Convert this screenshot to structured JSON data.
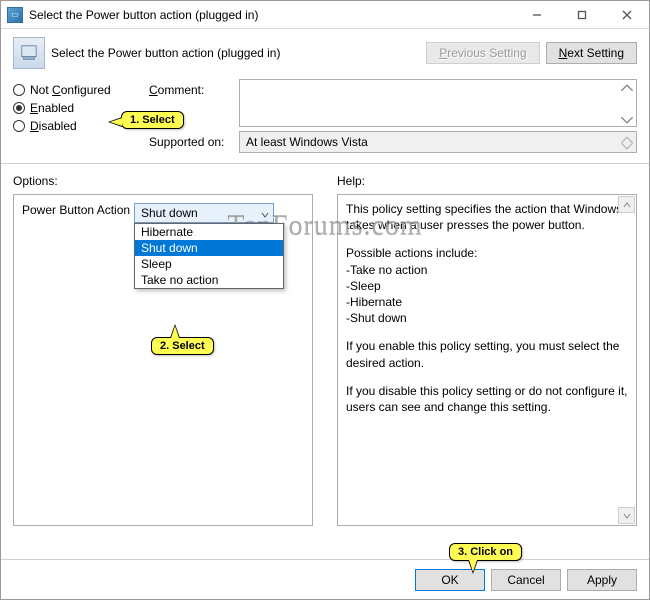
{
  "window": {
    "title": "Select the Power button action (plugged in)"
  },
  "header": {
    "title": "Select the Power button action (plugged in)",
    "previous_label": "Previous Setting",
    "next_label": "Next Setting"
  },
  "states": {
    "not_configured": "Not Configured",
    "enabled": "Enabled",
    "disabled": "Disabled",
    "selected": "enabled"
  },
  "fields": {
    "comment_label": "Comment:",
    "comment_value": "",
    "supported_label": "Supported on:",
    "supported_value": "At least Windows Vista"
  },
  "options": {
    "section_label": "Options:",
    "item_label": "Power Button Action",
    "selected": "Shut down",
    "items": [
      "Hibernate",
      "Shut down",
      "Sleep",
      "Take no action"
    ]
  },
  "help": {
    "section_label": "Help:",
    "p1": "This policy setting specifies the action that Windows takes when a user presses the power button.",
    "p2": "Possible actions include:",
    "li1": "-Take no action",
    "li2": "-Sleep",
    "li3": "-Hibernate",
    "li4": "-Shut down",
    "p3": "If you enable this policy setting, you must select the desired action.",
    "p4": "If you disable this policy setting or do not configure it, users can see and change this setting."
  },
  "buttons": {
    "ok": "OK",
    "cancel": "Cancel",
    "apply": "Apply"
  },
  "callouts": {
    "c1": "1. Select",
    "c2": "2. Select",
    "c3": "3. Click on"
  },
  "watermark": "TenForums.com"
}
